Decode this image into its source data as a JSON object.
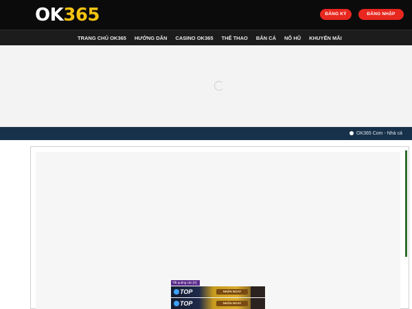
{
  "header": {
    "logo": {
      "part1": "OK",
      "part2": "365"
    },
    "register_label": "ĐĂNG KÝ",
    "login_label": "ĐĂNG NHẬP"
  },
  "nav": {
    "items": [
      {
        "label": "TRANG CHỦ OK365"
      },
      {
        "label": "HƯỚNG DẪN"
      },
      {
        "label": "CASINO OK365"
      },
      {
        "label": "THỂ THAO"
      },
      {
        "label": "BẮN CÁ"
      },
      {
        "label": "NỔ HŨ"
      },
      {
        "label": "KHUYẾN MÃI"
      }
    ]
  },
  "ticker": {
    "text": "OK365 Com - Nhà cá"
  },
  "ad": {
    "tag": "Tắt quảng cáo [X]",
    "banners": [
      {
        "brand": "TOP",
        "cta": "NHẬN NGAY"
      },
      {
        "brand": "TOP",
        "cta": "NHẬN NGAY"
      }
    ]
  },
  "colors": {
    "header_bg": "#0b0b0b",
    "nav_bg": "#1b1c1b",
    "accent_red": "#e8271f",
    "logo_yellow": "#f6c312",
    "ticker_bg": "#17314a"
  }
}
